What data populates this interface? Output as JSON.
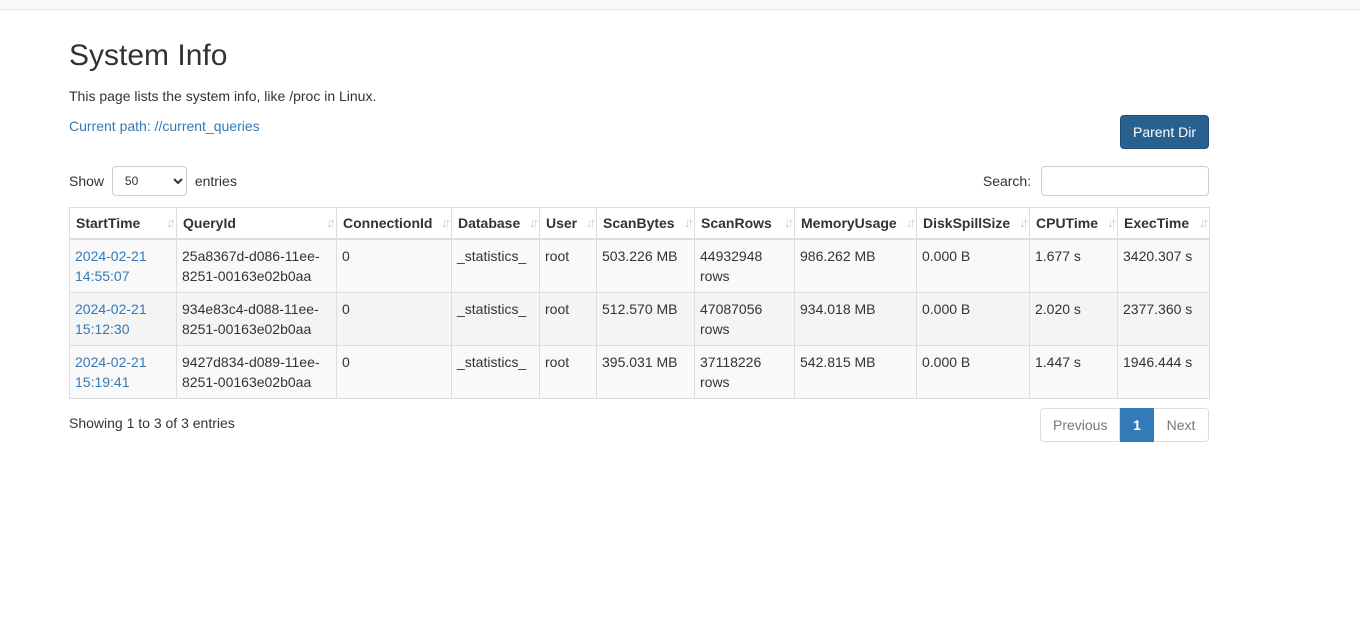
{
  "page": {
    "title": "System Info",
    "description": "This page lists the system info, like /proc in Linux.",
    "path_label": "Current path: //current_queries",
    "parent_button": "Parent Dir"
  },
  "controls": {
    "show_label": "Show",
    "page_size": "50",
    "entries_label": "entries",
    "search_label": "Search:",
    "search_value": ""
  },
  "table": {
    "columns": [
      "StartTime",
      "QueryId",
      "ConnectionId",
      "Database",
      "User",
      "ScanBytes",
      "ScanRows",
      "MemoryUsage",
      "DiskSpillSize",
      "CPUTime",
      "ExecTime"
    ],
    "rows": [
      [
        "2024-02-21 14:55:07",
        "25a8367d-d086-11ee-8251-00163e02b0aa",
        "0",
        "_statistics_",
        "root",
        "503.226 MB",
        "44932948 rows",
        "986.262 MB",
        "0.000 B",
        "1.677 s",
        "3420.307 s"
      ],
      [
        "2024-02-21 15:12:30",
        "934e83c4-d088-11ee-8251-00163e02b0aa",
        "0",
        "_statistics_",
        "root",
        "512.570 MB",
        "47087056 rows",
        "934.018 MB",
        "0.000 B",
        "2.020 s",
        "2377.360 s"
      ],
      [
        "2024-02-21 15:19:41",
        "9427d834-d089-11ee-8251-00163e02b0aa",
        "0",
        "_statistics_",
        "root",
        "395.031 MB",
        "37118226 rows",
        "542.815 MB",
        "0.000 B",
        "1.447 s",
        "1946.444 s"
      ]
    ]
  },
  "footer": {
    "info": "Showing 1 to 3 of 3 entries",
    "previous": "Previous",
    "current_page": "1",
    "next": "Next"
  },
  "icons": {
    "sort": "sort-both-icon"
  }
}
